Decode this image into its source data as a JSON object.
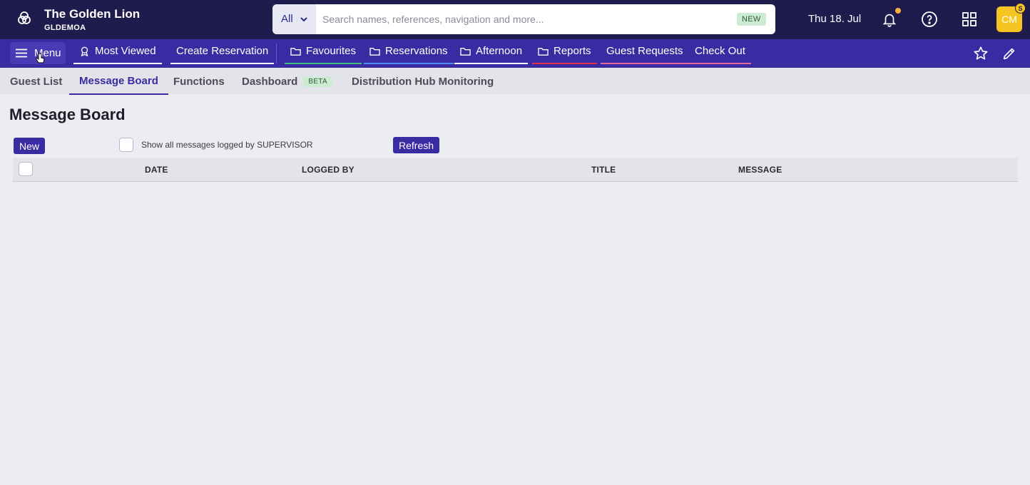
{
  "header": {
    "hotel_name": "The Golden Lion",
    "hotel_code": "GLDEMOA",
    "search": {
      "scope": "All",
      "placeholder": "Search names, references, navigation and more...",
      "badge": "NEW"
    },
    "date": "Thu 18. Jul",
    "avatar_initials": "CM",
    "avatar_badge": "S",
    "icons": [
      "logo-icon",
      "bell-icon",
      "help-icon",
      "apps-grid-icon"
    ]
  },
  "nav": {
    "menu_label": "Menu",
    "items": [
      {
        "label": "Most Viewed",
        "icon": "award-icon",
        "underline": "#ffffff"
      },
      {
        "label": "Create Reservation",
        "icon": null,
        "underline": "#ffffff"
      },
      {
        "label": "Favourites",
        "icon": "folder-icon",
        "underline": "#3fbf7f"
      },
      {
        "label": "Reservations",
        "icon": "folder-icon",
        "underline": "#4a8cf0"
      },
      {
        "label": "Afternoon",
        "icon": "folder-icon",
        "underline": "#ffffff"
      },
      {
        "label": "Reports",
        "icon": "folder-icon",
        "underline": "#e0304a"
      },
      {
        "label": "Guest Requests",
        "icon": null,
        "underline": "#e06aa0"
      },
      {
        "label": "Check Out",
        "icon": null,
        "underline": "#e06aa0"
      }
    ]
  },
  "tabs": [
    {
      "label": "Guest List",
      "active": false
    },
    {
      "label": "Message Board",
      "active": true
    },
    {
      "label": "Functions",
      "active": false
    },
    {
      "label": "Dashboard",
      "active": false,
      "badge": "BETA"
    },
    {
      "label": "Distribution Hub Monitoring",
      "active": false
    }
  ],
  "page": {
    "title": "Message Board",
    "new_button": "New",
    "show_all_label": "Show all messages logged by SUPERVISOR",
    "refresh_button": "Refresh",
    "table": {
      "columns": [
        "DATE",
        "LOGGED BY",
        "TITLE",
        "MESSAGE"
      ],
      "rows": []
    }
  },
  "colors": {
    "topbar": "#1f1b4d",
    "navbar": "#3b2ba3",
    "accent": "#3b2ba3",
    "avatar": "#f6c421",
    "badge_bg": "#cdebd3"
  }
}
